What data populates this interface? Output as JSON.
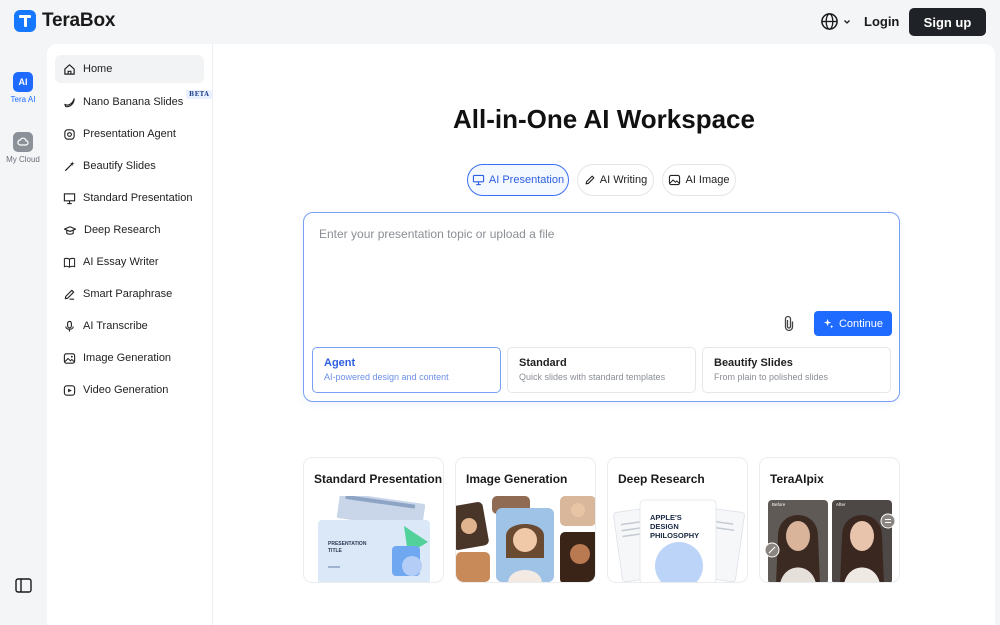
{
  "brand": {
    "name": "TeraBox"
  },
  "header": {
    "login_label": "Login",
    "signup_label": "Sign up",
    "language_icon": "globe-icon"
  },
  "rail": {
    "items": [
      {
        "label": "Tera AI",
        "icon": "ai-icon",
        "glyph": "AI",
        "color": "#1f6bff"
      },
      {
        "label": "My Cloud",
        "icon": "cloud-icon",
        "color": "#8b9099"
      }
    ]
  },
  "sidebar": {
    "items": [
      {
        "label": "Home",
        "icon": "home-icon"
      },
      {
        "label": "Nano Banana Slides",
        "icon": "banana-icon",
        "badge": "BETA"
      },
      {
        "label": "Presentation Agent",
        "icon": "agent-icon"
      },
      {
        "label": "Beautify Slides",
        "icon": "magic-wand-icon"
      },
      {
        "label": "Standard Presentation",
        "icon": "presentation-icon"
      },
      {
        "label": "Deep Research",
        "icon": "graduation-cap-icon"
      },
      {
        "label": "AI Essay Writer",
        "icon": "book-icon"
      },
      {
        "label": "Smart Paraphrase",
        "icon": "pen-icon"
      },
      {
        "label": "AI Transcribe",
        "icon": "microphone-icon"
      },
      {
        "label": "Image Generation",
        "icon": "image-icon"
      },
      {
        "label": "Video Generation",
        "icon": "video-icon"
      }
    ]
  },
  "main": {
    "headline": "All-in-One AI Workspace",
    "tabs": [
      {
        "label": "AI Presentation",
        "icon": "presentation-icon"
      },
      {
        "label": "AI Writing",
        "icon": "pen-icon"
      },
      {
        "label": "AI Image",
        "icon": "image-icon"
      }
    ],
    "composer": {
      "placeholder": "Enter your presentation topic or upload a file",
      "continue_label": "Continue",
      "attach_icon": "paperclip-icon"
    },
    "modes": [
      {
        "title": "Agent",
        "desc": "AI-powered design and content"
      },
      {
        "title": "Standard",
        "desc": "Quick slides with standard templates"
      },
      {
        "title": "Beautify Slides",
        "desc": "From plain to polished slides"
      }
    ],
    "cards": [
      {
        "title": "Standard Presentation",
        "art_text": [
          "PRESENTATION",
          "TITLE"
        ]
      },
      {
        "title": "Image Generation"
      },
      {
        "title": "Deep Research",
        "art_text": [
          "APPLE'S",
          "DESIGN",
          "PHILOSOPHY"
        ]
      },
      {
        "title": "TeraAIpix",
        "art_text": [
          "Before",
          "After"
        ]
      }
    ]
  },
  "colors": {
    "accent": "#1f6bff",
    "dark_button": "#1f2226",
    "panel": "#ffffff",
    "background": "#f4f5f7"
  }
}
